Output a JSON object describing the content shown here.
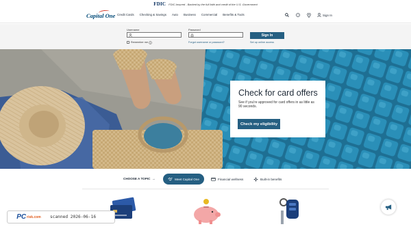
{
  "fdic": {
    "logo": "FDIC",
    "text": "FDIC-Insured - Backed by the full faith and credit of the U.S. Government"
  },
  "nav": {
    "brand": "Capital One",
    "links": [
      {
        "label": "Credit Cards"
      },
      {
        "label": "Checking & Savings"
      },
      {
        "label": "Auto"
      },
      {
        "label": "Business"
      },
      {
        "label": "Commercial"
      },
      {
        "label": "Benefits & Tools"
      }
    ],
    "sign_in": "Sign In",
    "icons": [
      "search-icon",
      "help-icon",
      "location-icon",
      "person-icon"
    ]
  },
  "signin": {
    "username_label": "Username",
    "password_label": "Password",
    "remember_me": "Remember me",
    "forgot_link": "Forgot username or password?",
    "button": "Sign In",
    "setup_link": "Set up online access"
  },
  "hero": {
    "title": "Check for card offers",
    "text": "See if you're approved for card offers in as little as 90 seconds.",
    "button": "Check my eligibility"
  },
  "topics": {
    "choose": "CHOOSE A TOPIC",
    "tabs": [
      {
        "label": "Meet Capital One",
        "active": true
      },
      {
        "label": "Financial wellness",
        "active": false
      },
      {
        "label": "Built-in benefits",
        "active": false
      }
    ]
  },
  "watermark": {
    "logo_pc": "PC",
    "logo_risk": "risk.com",
    "stamp": "scanned 2026-06-16"
  },
  "colors": {
    "brand": "#004977",
    "accent": "#d22e1e",
    "button": "#255f82",
    "tile_blue": "#2a8fb8"
  }
}
